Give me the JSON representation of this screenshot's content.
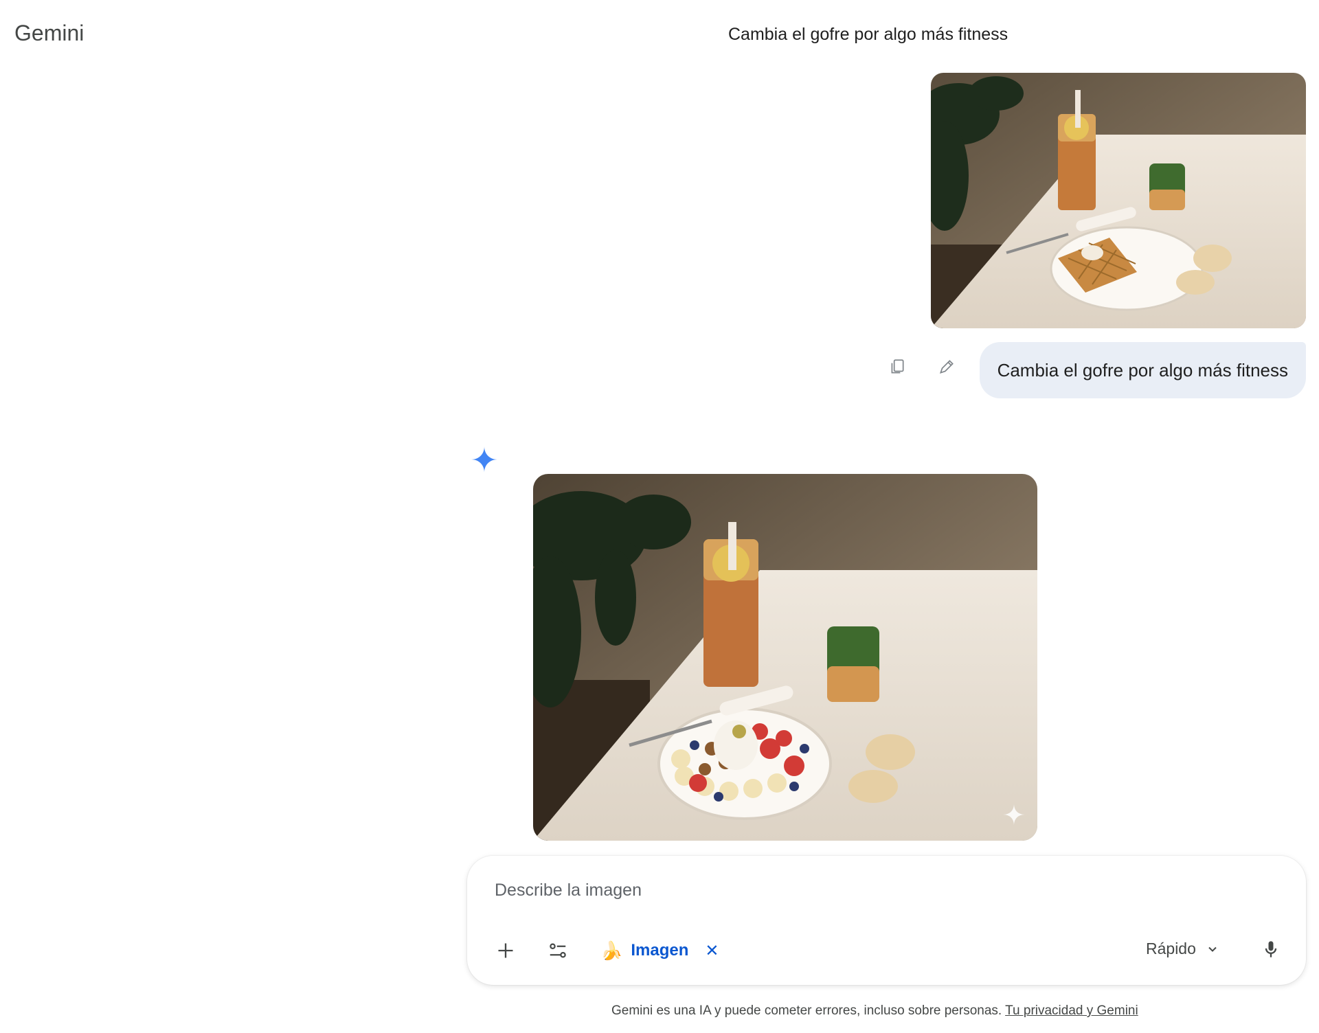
{
  "header": {
    "app_name": "Gemini",
    "conversation_title": "Cambia el gofre por algo más fitness"
  },
  "user_message": {
    "text": "Cambia el gofre por algo más fitness",
    "attachment_icon": "photo-thumbnail"
  },
  "response": {
    "avatar_icon": "gemini-spark-icon",
    "generated_image_icon": "sparkle-watermark-icon"
  },
  "composer": {
    "placeholder": "Describe la imagen",
    "tool_chip_emoji": "🍌",
    "tool_chip_label": "Imagen",
    "tool_chip_close": "✕",
    "model_label": "Rápido"
  },
  "footer": {
    "disclaimer": "Gemini es una IA y puede cometer errores, incluso sobre personas.",
    "privacy_link": "Tu privacidad y Gemini"
  },
  "colors": {
    "accent": "#0b57d0",
    "spark": "#4285f4",
    "bubble": "#e9eef6"
  }
}
